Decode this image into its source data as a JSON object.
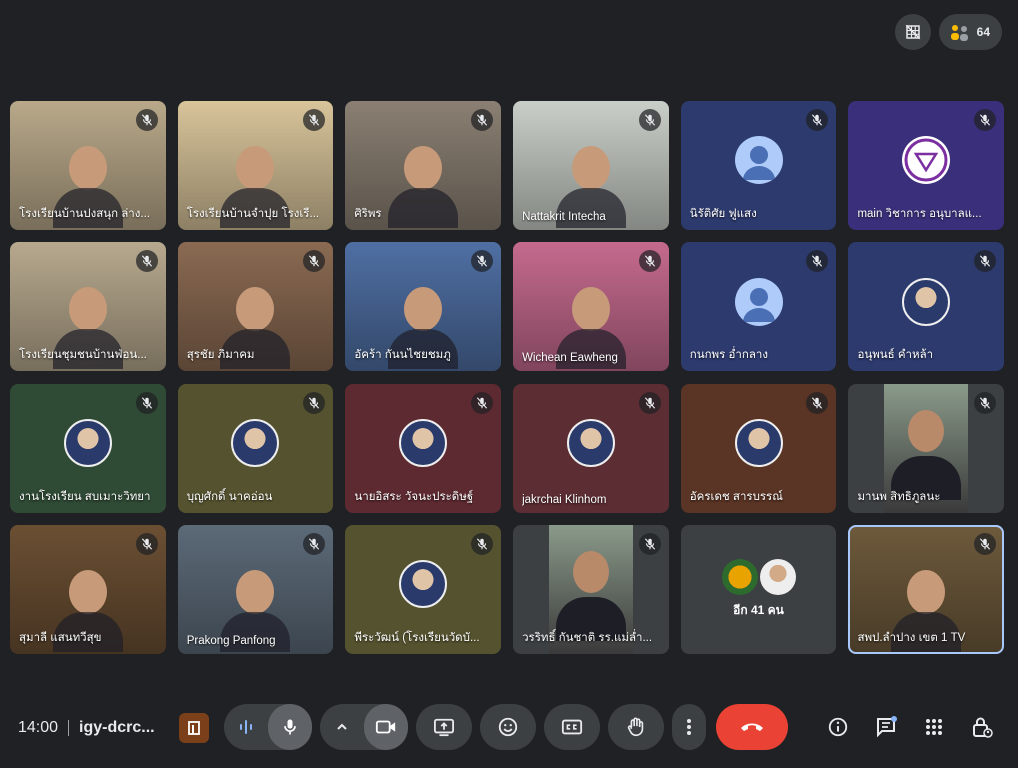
{
  "header": {
    "participant_count": "64",
    "colors": {
      "background": "#202124",
      "pill": "#3c4043"
    }
  },
  "tiles": [
    {
      "name": "โรงเรียนบ้านปงสนุก ล่าง...",
      "kind": "video",
      "bg": "#b9a98a"
    },
    {
      "name": "โรงเรียนบ้านจำปุย โรงเรี...",
      "kind": "video",
      "bg": "#d8c49a"
    },
    {
      "name": "ศิริพร",
      "kind": "video",
      "bg": "#8a7f72"
    },
    {
      "name": "Nattakrit Intecha",
      "kind": "video",
      "bg": "#c9cfc8"
    },
    {
      "name": "นิรัติศัย ฟูแสง",
      "kind": "avatar",
      "bg": "#2d3a6e"
    },
    {
      "name": "main วิชาการ อนุบาลแ...",
      "kind": "logo",
      "bg": "#3a2f7a"
    },
    {
      "name": "โรงเรียนชุมชนบ้านฟ่อน...",
      "kind": "video",
      "bg": "#b7a98e"
    },
    {
      "name": "สุรชัย ภิมาคม",
      "kind": "video",
      "bg": "#8a6a52"
    },
    {
      "name": "อัคร้า กันนไชยชมภู",
      "kind": "video",
      "bg": "#4f6fa3"
    },
    {
      "name": "Wichean Eawheng",
      "kind": "video",
      "bg": "#c56a8e"
    },
    {
      "name": "กนกพร อ่ำกลาง",
      "kind": "avatar",
      "bg": "#2d3a6e"
    },
    {
      "name": "อนุพนธ์ คำหล้า",
      "kind": "photo",
      "bg": "#2d3a6e"
    },
    {
      "name": "งานโรงเรียน สบเมาะวิทยา",
      "kind": "photo",
      "bg": "#2f4a35"
    },
    {
      "name": "บุญศักดิ์ นาคอ่อน",
      "kind": "photo",
      "bg": "#55532f"
    },
    {
      "name": "นายอิสระ วัจนะประดิษฐ์",
      "kind": "photo",
      "bg": "#5e2a31"
    },
    {
      "name": "jakrchai Klinhom",
      "kind": "photo",
      "bg": "#5c2d33"
    },
    {
      "name": "อัครเดช สารบรรณ์",
      "kind": "photo",
      "bg": "#5a3424"
    },
    {
      "name": "มานพ สิทธิภูลนะ",
      "kind": "video-narrow",
      "bg": "#3c4043"
    },
    {
      "name": "สุมาลี แสนทวีสุข",
      "kind": "video",
      "bg": "#6b4f33"
    },
    {
      "name": "Prakong Panfong",
      "kind": "video",
      "bg": "#5c6a78"
    },
    {
      "name": "พีระวัฒน์ (โรงเรียนวัดบั...",
      "kind": "photo",
      "bg": "#55532f"
    },
    {
      "name": "วรริทธิ์ กันชาติ รร.แม่ล่ำ...",
      "kind": "video-narrow",
      "bg": "#3c4043"
    },
    {
      "name": "",
      "kind": "more",
      "bg": "#3c4043",
      "more_label": "อีก 41 คน"
    },
    {
      "name": "สพป.ลำปาง เขต 1 TV",
      "kind": "video",
      "bg": "#6e5a3c",
      "active": true
    }
  ],
  "controls": {
    "time": "14:00",
    "meeting_code": "igy-dcrc...",
    "end_color": "#ea4335"
  }
}
